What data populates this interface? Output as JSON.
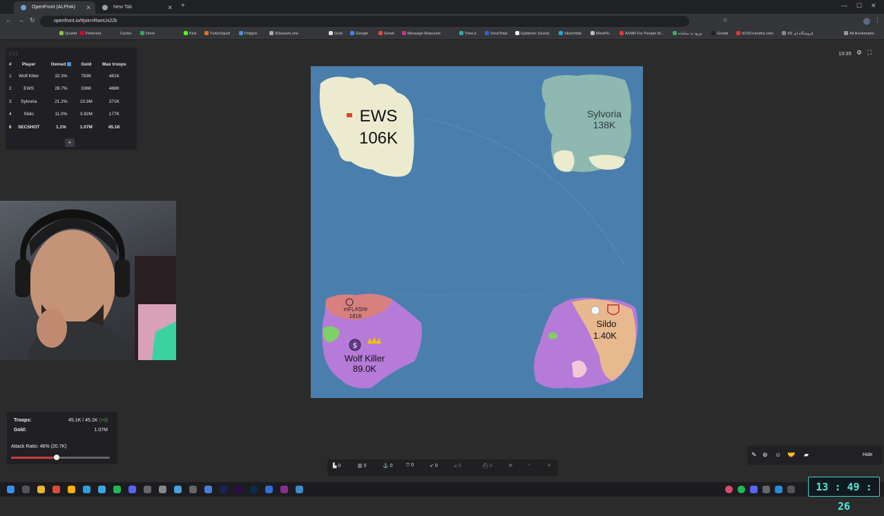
{
  "browser": {
    "tabs": [
      {
        "label": "OpenFront (ALPHA)",
        "active": true
      },
      {
        "label": "New Tab",
        "active": false
      }
    ],
    "url": "openfront.io/#join=RwnUx22k",
    "bookmarks": [
      "Quizlet",
      "Pinterest",
      "Cooler",
      "Drive",
      "Kick",
      "TurboSquid",
      "Poligon",
      "3Dassets.one",
      "Grok",
      "Google",
      "Gmail",
      "Message Requests",
      "Time.ir",
      "VirusTotal",
      "Epidemic Sound",
      "Sketchfab",
      "MinePic",
      "ASMR For People W...",
      "ورود به سامانه",
      "Goods",
      "hi230.irandns.com",
      "فروشگاه ای کالا"
    ],
    "all_bookmarks": "All Bookmarks"
  },
  "leaderboard": {
    "headers": [
      "#",
      "Player",
      "Owned",
      "Gold",
      "Max troops"
    ],
    "rows": [
      {
        "rank": "1",
        "player": "Wolf Killer",
        "owned": "32.3%",
        "gold": "793K",
        "troops": "481K"
      },
      {
        "rank": "2",
        "player": "EWS",
        "owned": "28.7%",
        "gold": "336K",
        "troops": "488K"
      },
      {
        "rank": "3",
        "player": "Sylvoria",
        "owned": "21.2%",
        "gold": "10.3M",
        "troops": "371K"
      },
      {
        "rank": "4",
        "player": "Sildo",
        "owned": "11.0%",
        "gold": "3.92M",
        "troops": "177K"
      },
      {
        "rank": "6",
        "player": "SECSHOT",
        "owned": "1.1%",
        "gold": "1.07M",
        "troops": "45.1K"
      }
    ],
    "add_label": "+"
  },
  "map": {
    "water_color": "#4a7fad",
    "labels": [
      {
        "name": "EWS",
        "troops": "106K"
      },
      {
        "name": "Sylvoria",
        "troops": "138K"
      },
      {
        "name": "mFLASHr",
        "troops": "181K"
      },
      {
        "name": "Wolf Killer",
        "troops": "89.0K"
      },
      {
        "name": "Sildo",
        "troops": "1.40K"
      }
    ]
  },
  "hud": {
    "time": "13:35",
    "troops_label": "Troops:",
    "troops_value": "45.1K / 45.1K",
    "troops_delta": "(+0)",
    "gold_label": "Gold:",
    "gold_value": "1.07M",
    "attack_ratio_label": "Attack Ratio: 46% (20.7K)",
    "attack_ratio": 0.46
  },
  "buildbar": [
    "0",
    "0",
    "0",
    "0",
    "0",
    "0",
    "0"
  ],
  "actionbar": {
    "hide_label": "Hide"
  },
  "taskbar": {
    "clock": "13 : 49 : 26"
  },
  "colors": {
    "ews": "#ecebd0",
    "sylvoria": "#8fb8b0",
    "wolf_killer": "#b67ad8",
    "flash": "#d88080",
    "sildo": "#e8b88f",
    "clock": "#4fe8da"
  }
}
